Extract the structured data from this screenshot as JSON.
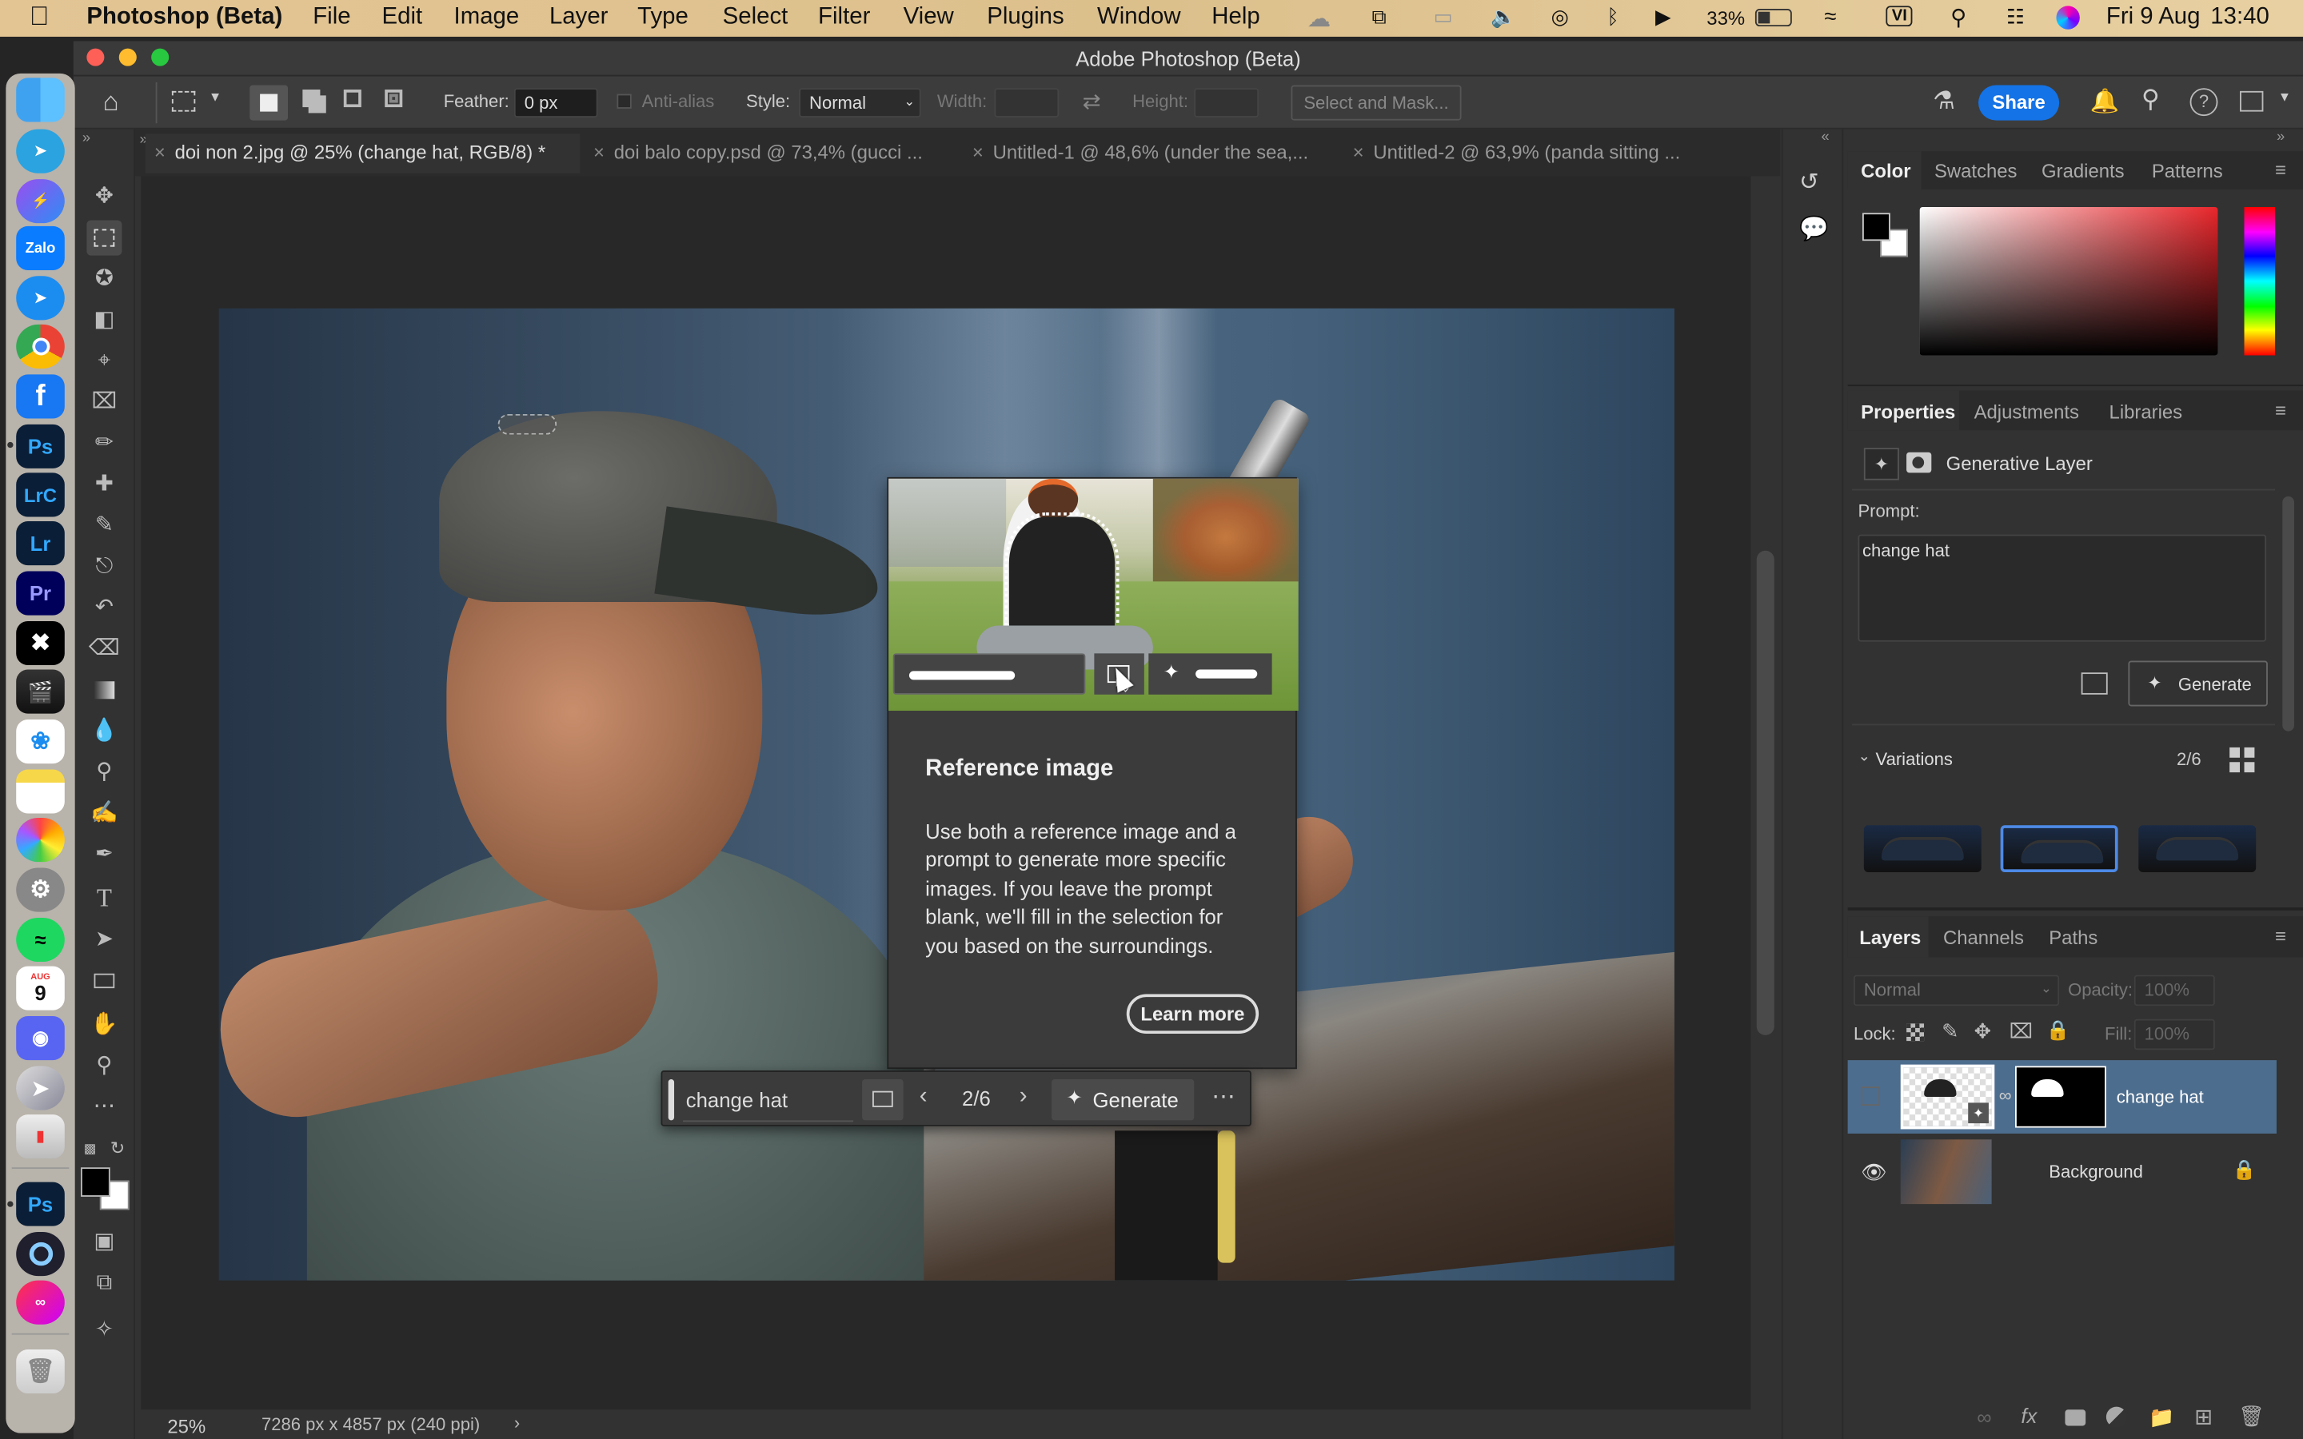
{
  "menubar": {
    "app": "Photoshop (Beta)",
    "items": [
      "File",
      "Edit",
      "Image",
      "Layer",
      "Type",
      "Select",
      "Filter",
      "View",
      "Plugins",
      "Window",
      "Help"
    ],
    "battery": "33%",
    "date": "Fri 9 Aug",
    "time": "13:40",
    "input_source": "VI"
  },
  "window": {
    "title": "Adobe Photoshop (Beta)"
  },
  "options": {
    "feather_label": "Feather:",
    "feather_value": "0 px",
    "anti_alias": "Anti-alias",
    "style_label": "Style:",
    "style_value": "Normal",
    "width_label": "Width:",
    "height_label": "Height:",
    "select_mask": "Select and Mask...",
    "share": "Share"
  },
  "tabs": [
    "doi non 2.jpg @ 25% (change hat, RGB/8) *",
    "doi balo copy.psd @ 73,4% (gucci ...",
    "Untitled-1 @ 48,6% (under the sea,...",
    "Untitled-2 @ 63,9% (panda sitting ..."
  ],
  "status": {
    "zoom": "25%",
    "doc_info": "7286 px x 4857 px (240 ppi)"
  },
  "tooltip": {
    "title": "Reference image",
    "body": "Use both a reference image and a prompt to generate more specific images. If you leave the prompt blank, we'll fill in the selection for you based on the surroundings.",
    "learn_more": "Learn more"
  },
  "ctxbar": {
    "prompt": "change hat",
    "counter": "2/6",
    "generate": "Generate"
  },
  "color_panel": {
    "tabs": [
      "Color",
      "Swatches",
      "Gradients",
      "Patterns"
    ]
  },
  "properties": {
    "tabs": [
      "Properties",
      "Adjustments",
      "Libraries"
    ],
    "layer_type": "Generative Layer",
    "prompt_label": "Prompt:",
    "prompt_value": "change hat",
    "generate": "Generate",
    "variations_label": "Variations",
    "variations_count": "2/6"
  },
  "layers": {
    "tabs": [
      "Layers",
      "Channels",
      "Paths"
    ],
    "blend": "Normal",
    "opacity_label": "Opacity:",
    "opacity_value": "100%",
    "lock_label": "Lock:",
    "fill_label": "Fill:",
    "fill_value": "100%",
    "items": [
      {
        "name": "change hat"
      },
      {
        "name": "Background"
      }
    ]
  },
  "colors": {
    "accent": "#1473e6",
    "bg": "#323232",
    "canvas": "#252525",
    "selection": "#4d6d8e"
  }
}
